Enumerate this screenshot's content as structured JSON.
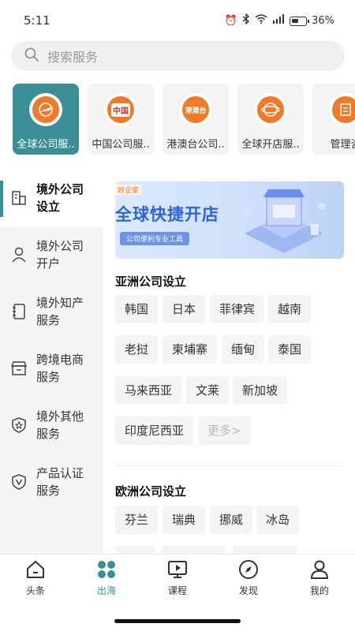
{
  "status_bar": {
    "time": "5:11",
    "battery": "36%"
  },
  "search": {
    "placeholder": "搜索服务"
  },
  "categories": [
    {
      "label": "全球公司服..",
      "icon": "globe-plane-icon",
      "active": true
    },
    {
      "label": "中国公司服..",
      "icon": "china-badge-icon",
      "badge": "中国"
    },
    {
      "label": "港澳台公司..",
      "icon": "hk-macao-tw-badge-icon",
      "badge": "港澳台"
    },
    {
      "label": "全球开店服..",
      "icon": "globe-store-icon"
    },
    {
      "label": "管理咨",
      "icon": "consulting-icon"
    }
  ],
  "sidebar": {
    "items": [
      {
        "label": "境外公司设立",
        "icon": "building-icon",
        "active": true
      },
      {
        "label": "境外公司开户",
        "icon": "user-icon"
      },
      {
        "label": "境外知产服务",
        "icon": "notebook-icon"
      },
      {
        "label": "跨境电商服务",
        "icon": "store-icon"
      },
      {
        "label": "境外其他服务",
        "icon": "star-shield-icon"
      },
      {
        "label": "产品认证服务",
        "icon": "check-shield-icon"
      }
    ]
  },
  "banner": {
    "tag": "好企家",
    "title": "全球快捷开店",
    "subtitle": "公司便利专业工具"
  },
  "sections": [
    {
      "title": "亚洲公司设立",
      "chips": [
        "韩国",
        "日本",
        "菲律宾",
        "越南",
        "老挝",
        "柬埔寨",
        "缅甸",
        "泰国",
        "马来西亚",
        "文莱",
        "新加坡",
        "印度尼西亚"
      ],
      "more": "更多>"
    },
    {
      "title": "欧洲公司设立",
      "chips": [
        "芬兰",
        "瑞典",
        "挪威",
        "冰岛"
      ]
    }
  ],
  "tabbar": {
    "items": [
      {
        "label": "头条",
        "icon": "home-icon"
      },
      {
        "label": "出海",
        "icon": "grid-clover-icon",
        "active": true
      },
      {
        "label": "课程",
        "icon": "video-course-icon"
      },
      {
        "label": "发现",
        "icon": "compass-icon"
      },
      {
        "label": "我的",
        "icon": "profile-icon"
      }
    ]
  },
  "colors": {
    "accent": "#3a8f96",
    "banner_blue": "#2b63d9",
    "chip_bg": "#f4f4f4"
  }
}
